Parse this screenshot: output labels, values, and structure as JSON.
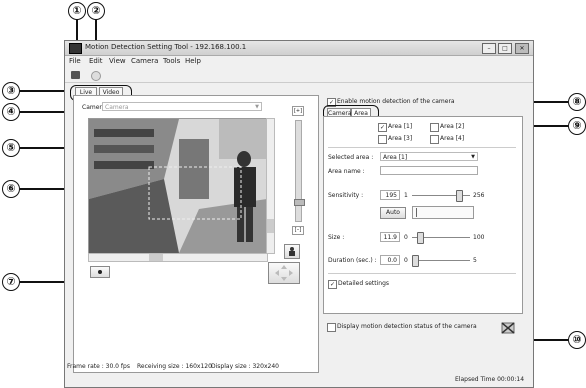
{
  "window": {
    "title": "Motion Detection Setting Tool - 192.168.100.1"
  },
  "menu": [
    "File",
    "Edit",
    "View",
    "Camera",
    "Tools",
    "Help"
  ],
  "tabs": {
    "live": "Live",
    "video": "Video"
  },
  "camera_combo": {
    "label": "Camera",
    "value": "Camera"
  },
  "enable_checkbox": {
    "label": "Enable motion detection of the camera",
    "checked": true
  },
  "subtabs": {
    "camera": "Camera",
    "area": "Area"
  },
  "areas": [
    {
      "label": "Area [1]",
      "checked": true
    },
    {
      "label": "Area [2]",
      "checked": false
    },
    {
      "label": "Area [3]",
      "checked": false
    },
    {
      "label": "Area [4]",
      "checked": false
    }
  ],
  "selected_area": {
    "label": "Selected area :",
    "value": "Area [1]"
  },
  "area_name": {
    "label": "Area name :",
    "value": ""
  },
  "sensitivity": {
    "label": "Sensitivity :",
    "value": "195",
    "min": "1",
    "max": "256",
    "fraction": 0.76
  },
  "auto_button": "Auto",
  "size": {
    "label": "Size :",
    "value": "11.9",
    "min": "0",
    "max": "100",
    "fraction": 0.12
  },
  "duration": {
    "label": "Duration (sec.) :",
    "value": "0.0",
    "min": "0",
    "max": "5",
    "fraction": 0.0
  },
  "detailed_settings": {
    "label": "Detailed settings",
    "checked": true
  },
  "display_status": {
    "label": "Display motion detection status of the camera",
    "checked": false
  },
  "status": {
    "frame_rate": "Frame rate : 30.0 fps",
    "receiving_size": "Receiving size : 160x120",
    "display_size": "Display size : 320x240",
    "elapsed": "Elapsed Time 00:00:14"
  },
  "callouts": [
    "①",
    "②",
    "③",
    "④",
    "⑤",
    "⑥",
    "⑦",
    "⑧",
    "⑨",
    "⑩"
  ]
}
